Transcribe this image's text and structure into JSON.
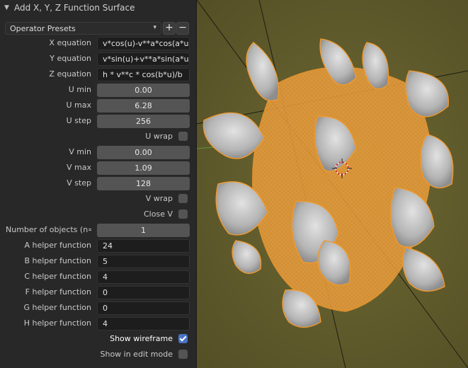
{
  "panel": {
    "title": "Add X, Y, Z Function Surface",
    "collapse_icon": "triangle-down",
    "presets_label": "Operator Presets",
    "add_symbol": "+",
    "remove_symbol": "−"
  },
  "fields": {
    "x_equation": {
      "label": "X equation",
      "value": "v*cos(u)-v**a*cos(a*u..."
    },
    "y_equation": {
      "label": "Y equation",
      "value": "v*sin(u)+v**a*sin(a*u..."
    },
    "z_equation": {
      "label": "Z equation",
      "value": "h * v**c * cos(b*u)/b"
    },
    "u_min": {
      "label": "U min",
      "value": "0.00"
    },
    "u_max": {
      "label": "U max",
      "value": "6.28"
    },
    "u_step": {
      "label": "U step",
      "value": "256"
    },
    "u_wrap": {
      "label": "U wrap",
      "checked": false
    },
    "v_min": {
      "label": "V min",
      "value": "0.00"
    },
    "v_max": {
      "label": "V max",
      "value": "1.09"
    },
    "v_step": {
      "label": "V step",
      "value": "128"
    },
    "v_wrap": {
      "label": "V wrap",
      "checked": false
    },
    "close_v": {
      "label": "Close V",
      "checked": false
    },
    "n_objects": {
      "label": "Number of objects (n=...",
      "value": "1"
    },
    "a_helper": {
      "label": "A helper function",
      "value": "24"
    },
    "b_helper": {
      "label": "B helper function",
      "value": "5"
    },
    "c_helper": {
      "label": "C helper function",
      "value": "4"
    },
    "f_helper": {
      "label": "F helper function",
      "value": "0"
    },
    "g_helper": {
      "label": "G helper function",
      "value": "0"
    },
    "h_helper": {
      "label": "H helper function",
      "value": "4"
    },
    "show_wireframe": {
      "label": "Show wireframe",
      "checked": true
    },
    "show_in_edit_mode": {
      "label": "Show in edit mode",
      "checked": false
    }
  },
  "colors": {
    "viewport_bg": "#5f5a2b",
    "selection_outline": "#f39a2c",
    "surface": "#b9b9b9",
    "axis_x": "#000000",
    "accent_checkbox": "#4a73c4"
  }
}
